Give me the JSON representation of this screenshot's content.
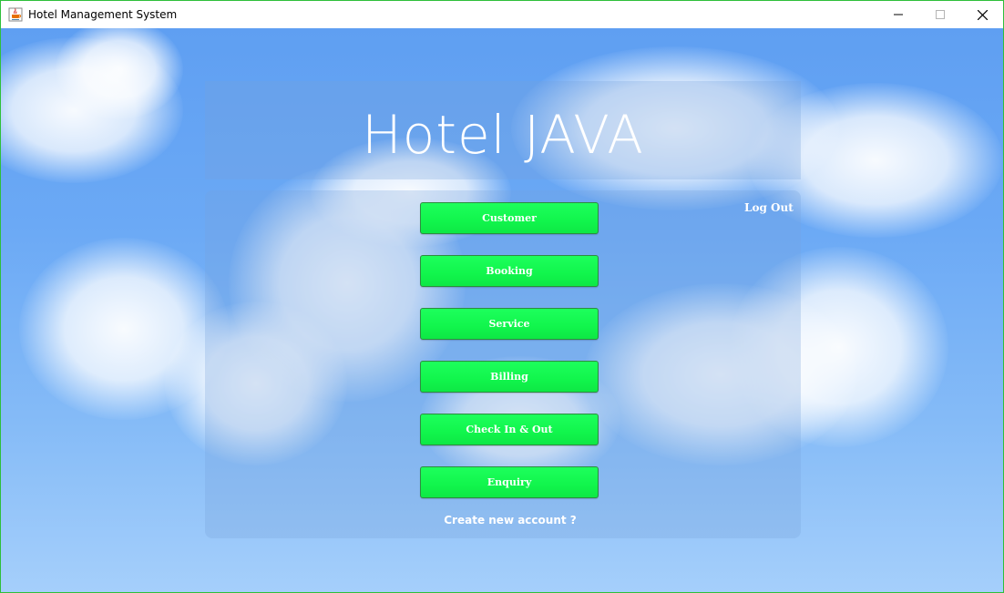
{
  "window": {
    "title": "Hotel Management System"
  },
  "header": {
    "title": "Hotel JAVA"
  },
  "menu": {
    "logout_label": "Log Out",
    "buttons": [
      {
        "label": "Customer"
      },
      {
        "label": "Booking"
      },
      {
        "label": "Service"
      },
      {
        "label": "Billing"
      },
      {
        "label": "Check In & Out"
      },
      {
        "label": "Enquiry"
      }
    ],
    "create_account_label": "Create new account ?"
  },
  "colors": {
    "button_fill": "#11f54c",
    "button_border": "#2d8c3e",
    "window_border": "#2fbf3a",
    "sky_top": "#5f9ff2",
    "sky_bottom": "#a5cffb"
  },
  "icons": {
    "app": "java-cup-icon",
    "minimize": "minimize-icon",
    "maximize": "maximize-icon",
    "close": "close-icon"
  }
}
